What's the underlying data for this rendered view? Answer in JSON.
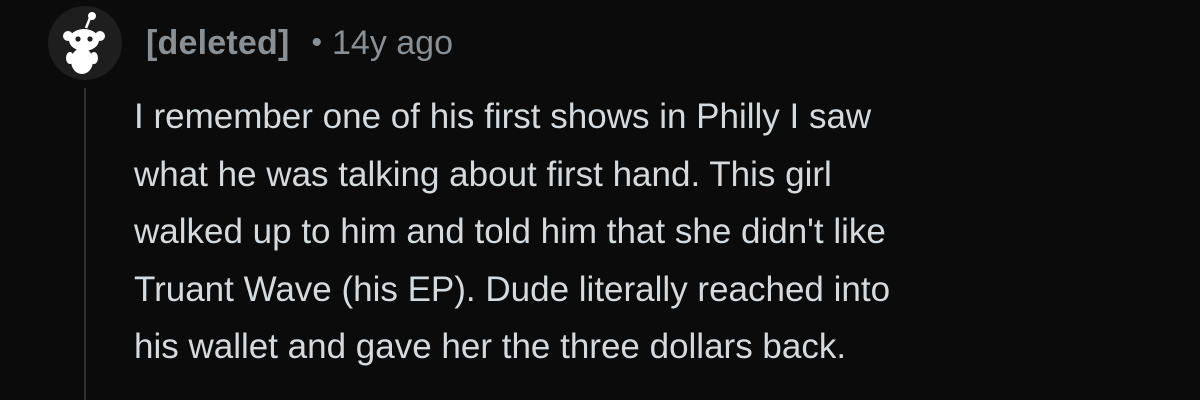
{
  "comment": {
    "author": "[deleted]",
    "separator": "•",
    "age": "14y ago",
    "body": "I remember one of his first shows in Philly I saw\nwhat he was talking about first hand. This girl\nwalked up to him and told him that she didn't like\nTruant Wave (his EP). Dude literally reached into\nhis wallet and gave her the three dollars back.",
    "avatar_icon": "snoo-avatar-icon"
  },
  "colors": {
    "background": "#0b0b0b",
    "author_text": "#8a8f94",
    "body_text": "#d7dadc",
    "thread_line": "#2f2f2f",
    "avatar_bg": "#1e1e1e"
  }
}
